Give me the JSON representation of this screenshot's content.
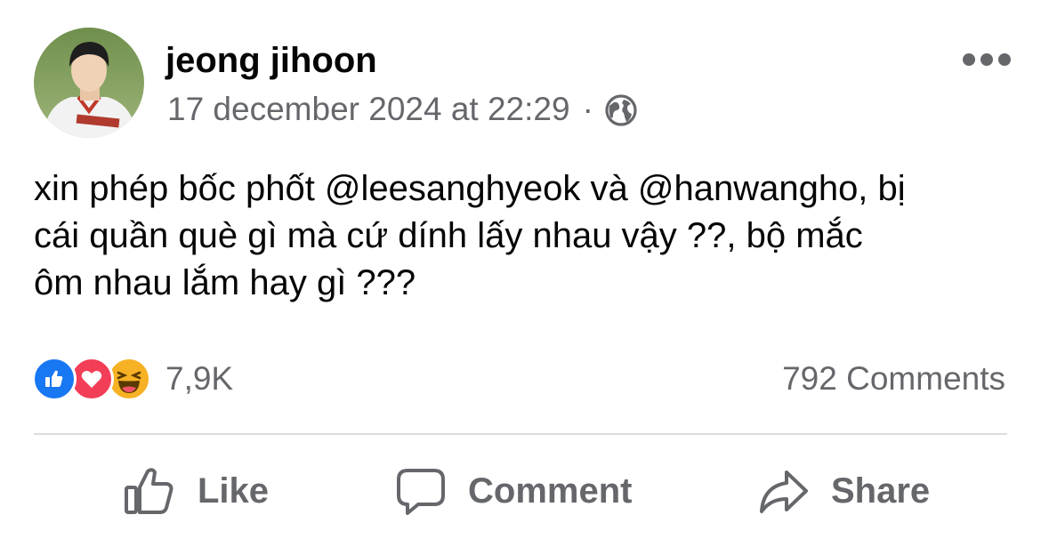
{
  "post": {
    "author": "jeong jihoon",
    "timestamp": "17 december 2024 at 22:29",
    "separator": "·",
    "audience_icon": "globe-icon",
    "more_icon": "more-options-icon",
    "text": "xin phép bốc phốt @leesanghyeok và @hanwangho, bị\ncái quần què gì mà cứ dính lấy nhau vậy ??, bộ mắc\nôm nhau lắm hay gì ???"
  },
  "reactions": {
    "icons": [
      "like-reaction-icon",
      "love-reaction-icon",
      "haha-reaction-icon"
    ],
    "count": "7,9K"
  },
  "comments_count": "792 Comments",
  "actions": {
    "like": "Like",
    "comment": "Comment",
    "share": "Share"
  },
  "colors": {
    "secondary_text": "#65676b",
    "like_blue": "#1877f2",
    "love_red": "#f33e58",
    "haha_yellow": "#f7b125",
    "divider": "#dadde1"
  }
}
